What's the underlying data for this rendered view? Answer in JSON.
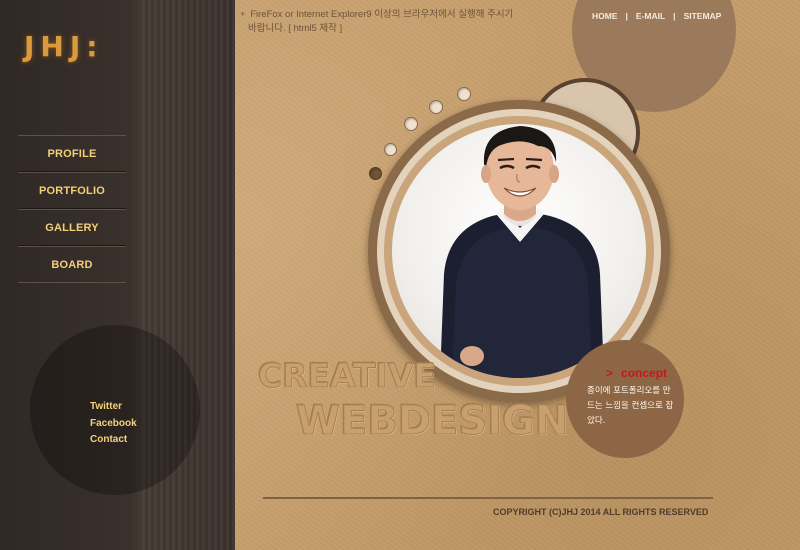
{
  "brand": {
    "logo_text": "JHJ:"
  },
  "nav": {
    "items": [
      {
        "label": "PROFILE"
      },
      {
        "label": "PORTFOLIO"
      },
      {
        "label": "GALLERY"
      },
      {
        "label": "BOARD"
      }
    ]
  },
  "social": {
    "links": [
      {
        "label": "Twitter"
      },
      {
        "label": "Facebook"
      },
      {
        "label": "Contact"
      }
    ]
  },
  "notice": {
    "bullet": "+",
    "line1": "FireFox or Internet Explorer9 이상의 브라우저에서 실행해 주시기",
    "line2": "바랍니다. [ html5 제작 ]"
  },
  "top_links": {
    "home": "HOME",
    "email": "E-MAIL",
    "sitemap": "SITEMAP",
    "separator": "|"
  },
  "hero": {
    "emboss_line1": "CREATIVE",
    "emboss_line2": "WEBDESIGN"
  },
  "concept": {
    "arrow": ">",
    "title": "concept",
    "description": "종이에 포트폴리오를 만드는 느낌을 컨셉으로 잡았다."
  },
  "footer": {
    "copyright": "COPYRIGHT (C)JHJ 2014 ALL RIGHTS RESERVED"
  },
  "colors": {
    "paper": "#c59d6b",
    "sidebar": "#3a312c",
    "nav_text": "#f3cf7c",
    "concept_accent": "#c8161d",
    "concept_bg": "#8c6645"
  }
}
